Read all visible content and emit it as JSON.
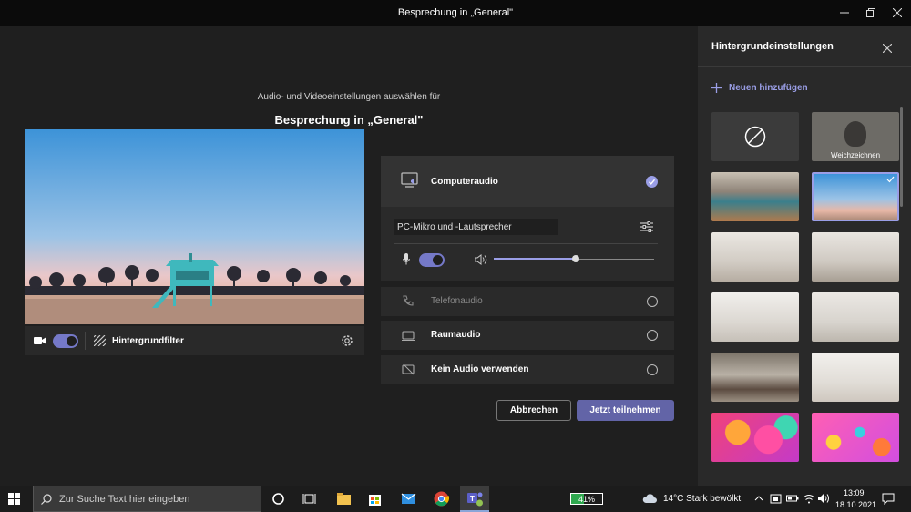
{
  "window": {
    "title": "Besprechung in „General\""
  },
  "main": {
    "subtitle": "Audio- und Videoeinstellungen auswählen für",
    "meeting_title": "Besprechung in „General\"",
    "preview_bar": {
      "filter_label": "Hintergrundfilter"
    }
  },
  "audio": {
    "computer_audio_label": "Computeraudio",
    "device_label": "PC-Mikro und -Lautsprecher",
    "volume_level": 0.51,
    "phone_label": "Telefonaudio",
    "room_label": "Raumaudio",
    "none_label": "Kein Audio verwenden"
  },
  "buttons": {
    "cancel": "Abbrechen",
    "join": "Jetzt teilnehmen"
  },
  "sidebar": {
    "title": "Hintergrundeinstellungen",
    "add_new": "Neuen hinzufügen",
    "blur_label": "Weichzeichnen"
  },
  "taskbar": {
    "search_placeholder": "Zur Suche Text hier eingeben",
    "battery": "41%",
    "weather": "14°C  Stark bewölkt",
    "time": "13:09",
    "date": "18.10.2021"
  },
  "colors": {
    "accent": "#7579c8",
    "background": "#1f1f1f",
    "panel": "#2a2a2a"
  }
}
